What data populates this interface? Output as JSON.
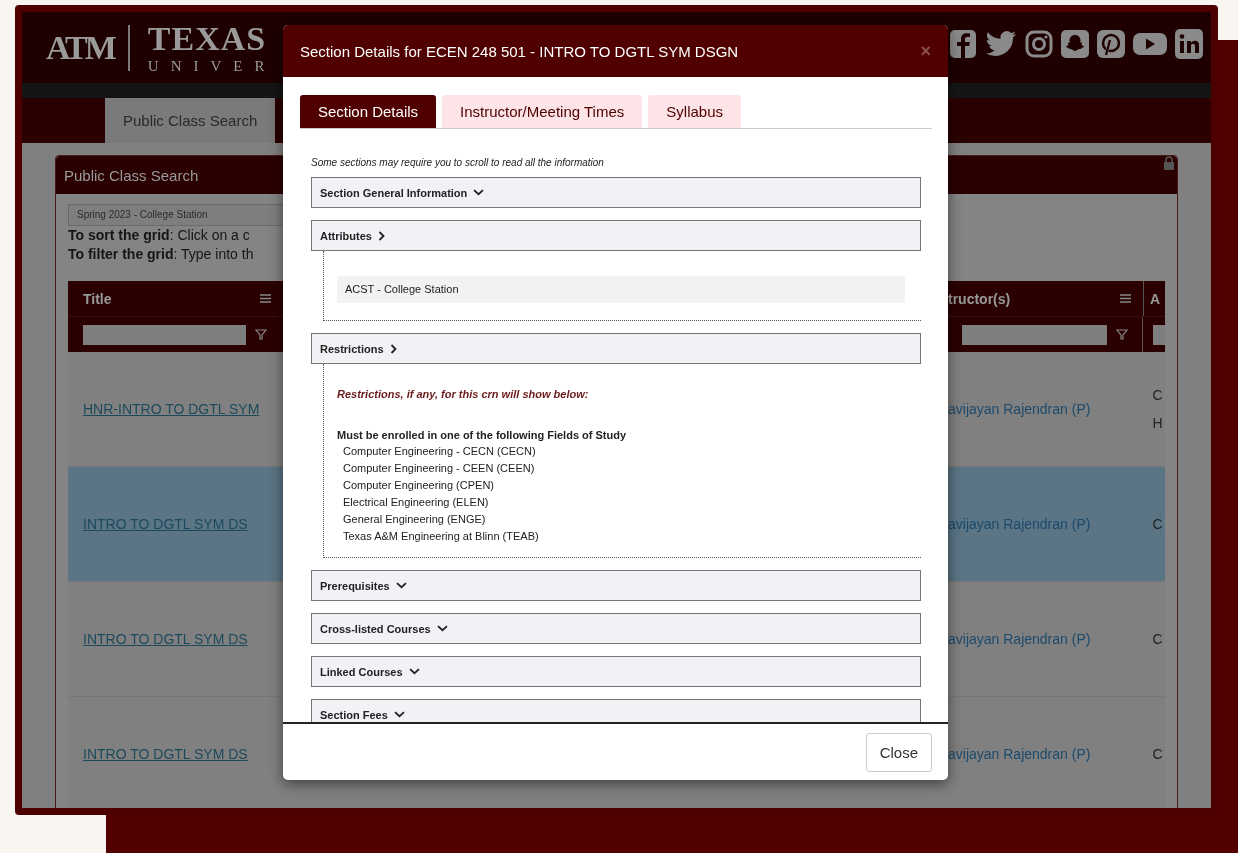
{
  "header": {
    "logo_mark": "ATM",
    "wordmark": "TEXAS",
    "wordmark_sub": "UNIVER"
  },
  "nav": {
    "tabs": [
      {
        "label": "Public Class Search",
        "selected": true
      }
    ]
  },
  "panel": {
    "title": "Public Class Search",
    "term_select": {
      "value": "Spring 2023 - College Station"
    },
    "instructions": [
      "**To sort the grid**: Click on a c",
      "**To filter the grid**: Type into th"
    ],
    "grid": {
      "columns": [
        {
          "label": "Title"
        },
        {
          "label": "tructor(s)"
        },
        {
          "label": "A"
        }
      ],
      "rows": [
        {
          "title": "HNR-INTRO TO DGTL SYM",
          "instructor": "avijayan Rajendran (P)",
          "column_3": [
            "C",
            "H"
          ],
          "selected": false
        },
        {
          "title": "INTRO TO DGTL SYM DS",
          "instructor": "avijayan Rajendran (P)",
          "column_3": [
            "C"
          ],
          "selected": true
        },
        {
          "title": "INTRO TO DGTL SYM DS",
          "instructor": "avijayan Rajendran (P)",
          "column_3": [
            "C"
          ],
          "selected": false
        },
        {
          "title": "INTRO TO DGTL SYM DS",
          "instructor": "avijayan Rajendran (P)",
          "column_3": [
            "C"
          ],
          "selected": false
        }
      ]
    }
  },
  "dialog": {
    "title": "Section Details for ECEN 248 501 - INTRO TO DGTL SYM DSGN",
    "close_icon": "×",
    "tabs": [
      {
        "label": "Section Details",
        "selected": true
      },
      {
        "label": "Instructor/Meeting Times",
        "selected": false
      },
      {
        "label": "Syllabus",
        "selected": false
      }
    ],
    "note": "Some sections may require you to scroll to read all the information",
    "sections": [
      {
        "title": "Section General Information",
        "expanded": false
      },
      {
        "title": "Attributes",
        "expanded": true,
        "kind": "attributes",
        "items": [
          "ACST - College Station"
        ]
      },
      {
        "title": "Restrictions",
        "expanded": true,
        "kind": "restrictions",
        "intro": "Restrictions, if any, for this crn will show below:",
        "heading": "Must be enrolled in one of the following Fields of Study",
        "items": [
          "Computer Engineering - CECN (CECN)",
          "Computer Engineering - CEEN (CEEN)",
          "Computer Engineering (CPEN)",
          "Electrical Engineering (ELEN)",
          "General Engineering (ENGE)",
          "Texas A&M Engineering at Blinn (TEAB)"
        ]
      },
      {
        "title": "Prerequisites",
        "expanded": false
      },
      {
        "title": "Cross-listed Courses",
        "expanded": false
      },
      {
        "title": "Linked Courses",
        "expanded": false
      },
      {
        "title": "Section Fees",
        "expanded": false
      }
    ],
    "close_button": "Close"
  }
}
